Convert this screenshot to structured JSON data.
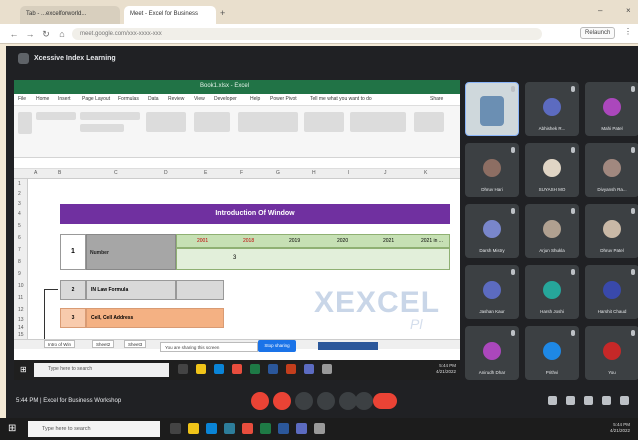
{
  "browser": {
    "tabs": [
      {
        "label": "Tab - ...excelforworld...",
        "active": false
      },
      {
        "label": "Meet - Excel for Business",
        "active": true
      }
    ],
    "url": "meet.google.com/xxx-xxxx-xxx",
    "menu_right": [
      "Relaunch",
      "⋮"
    ]
  },
  "meeting": {
    "title": "Xcessive Index Learning",
    "bottom_label": "5:44 PM | Excel for Business Workshop"
  },
  "excel": {
    "window_title": "Book1.xlsx - Excel",
    "menu": [
      "File",
      "Home",
      "Insert",
      "Page Layout",
      "Formulas",
      "Data",
      "Review",
      "View",
      "Developer",
      "Help",
      "Power Pivot",
      "Tell me what you want to do",
      "Share"
    ],
    "columns": [
      "A",
      "B",
      "C",
      "D",
      "E",
      "F",
      "G",
      "H",
      "I",
      "J",
      "K"
    ],
    "rows": [
      "1",
      "2",
      "3",
      "4",
      "5",
      "6",
      "7",
      "8",
      "9",
      "10",
      "11",
      "12",
      "13",
      "14",
      "15"
    ],
    "banner": "Introduction Of Window",
    "row1_number": "1",
    "row1_label": "Number",
    "headers": [
      "2001",
      "2018",
      "2019",
      "2020",
      "2021",
      "2021 in ..."
    ],
    "value_cell": "3",
    "row2_number": "2",
    "row2_label": "IN Law Formula",
    "row3_number": "3",
    "row3_label": "Cell, Cell Address",
    "watermark": "XEXCEL",
    "watermark_small": "Pl",
    "sheet_tabs": [
      "Intro of Win",
      "Sheet2",
      "Sheet3"
    ],
    "notify_text": "You are sharing this screen",
    "stop_share": "Stop sharing",
    "taskbar_search": "Type here to search",
    "taskbar_clock": [
      "5:44 PM",
      "4/21/2022"
    ]
  },
  "participants": [
    {
      "name": "",
      "color": "#6b8fb3",
      "self": true
    },
    {
      "name": "Abhishek R...",
      "color": "#5c6bc0"
    },
    {
      "name": "Mahi Patel",
      "color": "#ab47bc"
    },
    {
      "name": "Dhruv Hari",
      "color": "#8d6e63"
    },
    {
      "name": "SUYASH MO",
      "color": "#e0d5c5"
    },
    {
      "name": "Divyansh Ra...",
      "color": "#a1887f"
    },
    {
      "name": "Darsh Mistry",
      "color": "#7986cb"
    },
    {
      "name": "Arjun Shukla",
      "color": "#b0a090"
    },
    {
      "name": "Dhruv Patel",
      "color": "#c9b8a6"
    },
    {
      "name": "Jashan Kaur",
      "color": "#5c6bc0"
    },
    {
      "name": "Harsh Joshi",
      "color": "#26a69a"
    },
    {
      "name": "Harshit Chaud",
      "color": "#3949ab"
    },
    {
      "name": "Anirudh Dhar",
      "color": "#ab47bc"
    },
    {
      "name": "Prithvi",
      "color": "#1e88e5"
    },
    {
      "name": "You",
      "color": "#c62828"
    }
  ],
  "os_taskbar": {
    "search": "Type here to search",
    "clock": [
      "5:44 PM",
      "4/21/2022"
    ]
  },
  "colors": {
    "excel_green": "#217346",
    "banner_purple": "#7030a0",
    "meet_bg": "#202124",
    "end_call": "#ea4335"
  }
}
